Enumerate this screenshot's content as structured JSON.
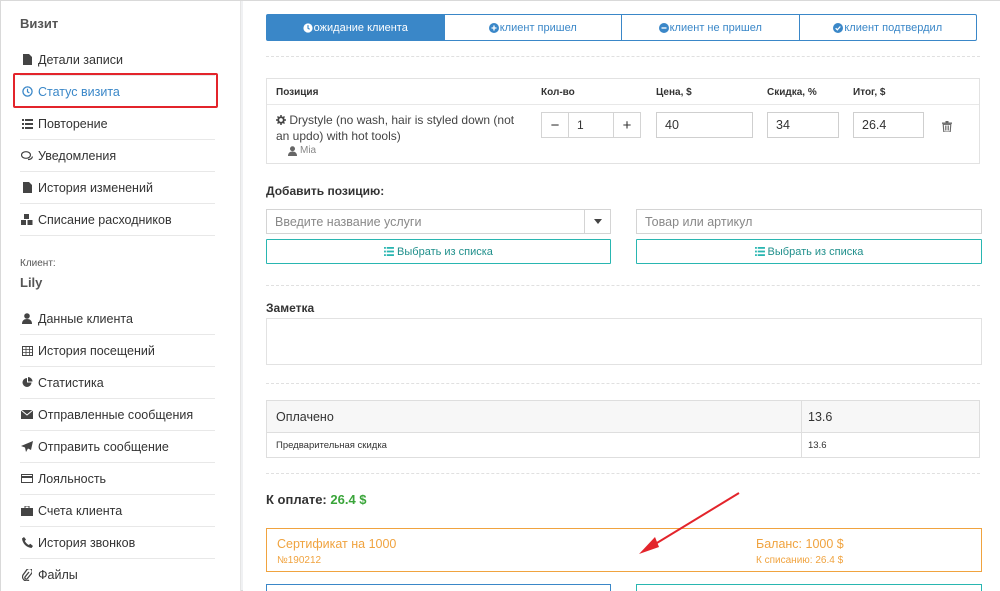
{
  "sidebar": {
    "title": "Визит",
    "items": [
      {
        "label": "Детали записи",
        "icon": "file-icon"
      },
      {
        "label": "Статус визита",
        "icon": "clock-icon"
      },
      {
        "label": "Повторение",
        "icon": "list-icon"
      },
      {
        "label": "Уведомления",
        "icon": "chat-icon"
      },
      {
        "label": "История изменений",
        "icon": "file-icon"
      },
      {
        "label": "Списание расходников",
        "icon": "cubes-icon"
      }
    ],
    "client_label": "Клиент:",
    "client_name": "Lily",
    "client_items": [
      {
        "label": "Данные клиента",
        "icon": "user-icon"
      },
      {
        "label": "История посещений",
        "icon": "table-icon"
      },
      {
        "label": "Статистика",
        "icon": "pie-icon"
      },
      {
        "label": "Отправленные сообщения",
        "icon": "envelope-icon"
      },
      {
        "label": "Отправить сообщение",
        "icon": "send-icon"
      },
      {
        "label": "Лояльность",
        "icon": "card-icon"
      },
      {
        "label": "Счета клиента",
        "icon": "briefcase-icon"
      },
      {
        "label": "История звонков",
        "icon": "phone-icon"
      },
      {
        "label": "Файлы",
        "icon": "paperclip-icon"
      }
    ]
  },
  "status_tabs": [
    {
      "label": "ожидание клиента",
      "icon": "clock-icon",
      "active": true
    },
    {
      "label": "клиент пришел",
      "icon": "plus-circle-icon",
      "active": false
    },
    {
      "label": "клиент не пришел",
      "icon": "minus-circle-icon",
      "active": false
    },
    {
      "label": "клиент подтвердил",
      "icon": "check-circle-icon",
      "active": false
    }
  ],
  "items_table": {
    "headers": {
      "position": "Позиция",
      "qty": "Кол-во",
      "price": "Цена, $",
      "discount": "Скидка, %",
      "total": "Итог, $"
    },
    "row": {
      "name": "Drystyle (no wash, hair is styled down (not an updo) with hot tools)",
      "master": "Mia",
      "qty": "1",
      "price": "40",
      "discount": "34",
      "total": "26.4"
    }
  },
  "add_position": {
    "label": "Добавить позицию:",
    "service_placeholder": "Введите название услуги",
    "product_placeholder": "Товар или артикул",
    "choose_label": "Выбрать из списка"
  },
  "note": {
    "label": "Заметка"
  },
  "payment": {
    "paid_label": "Оплачено",
    "paid_value": "13.6",
    "prediscount_label": "Предварительная скидка",
    "prediscount_value": "13.6"
  },
  "to_pay": {
    "label": "К оплате:",
    "amount": "26.4 $"
  },
  "certificate": {
    "name": "Сертификат на 1000",
    "number": "№190212",
    "balance": "Баланс: 1000 $",
    "writeoff": "К списанию: 26.4 $"
  },
  "colors": {
    "primary": "#3a87c8",
    "teal": "#29b6b1",
    "orange": "#f0a33f",
    "green": "#3aa53a",
    "highlight": "#e3242b"
  }
}
